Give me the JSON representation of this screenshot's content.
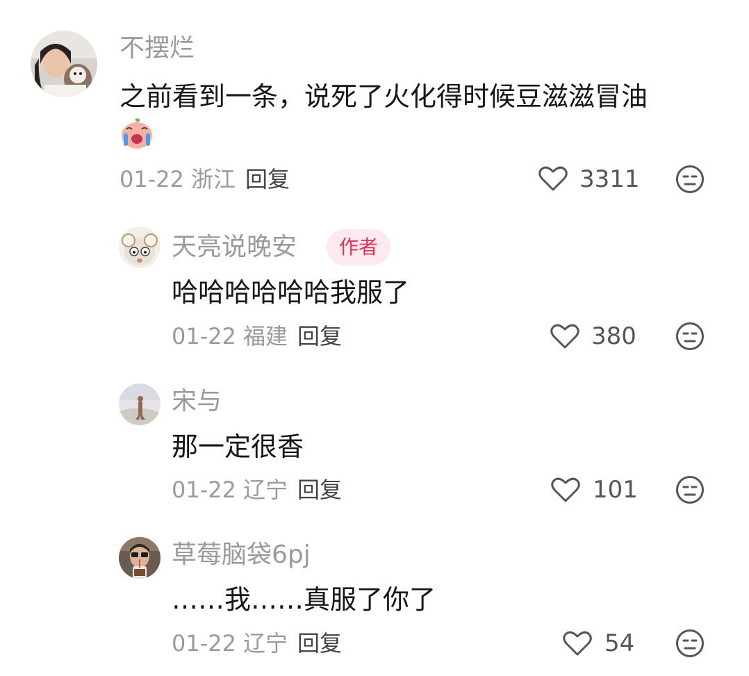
{
  "comments": [
    {
      "author": "不摆烂",
      "text": "之前看到一条，说死了火化得时候豆滋滋冒油",
      "emoji": "crying-laughing-emoji",
      "date": "01-22",
      "location": "浙江",
      "reply_label": "回复",
      "likes": "3311",
      "badge": null
    },
    {
      "author": "天亮说晚安",
      "badge": "作者",
      "text": "哈哈哈哈哈哈我服了",
      "date": "01-22",
      "location": "福建",
      "reply_label": "回复",
      "likes": "380"
    },
    {
      "author": "宋与",
      "text": "那一定很香",
      "date": "01-22",
      "location": "辽宁",
      "reply_label": "回复",
      "likes": "101",
      "badge": null
    },
    {
      "author": "草莓脑袋6pj",
      "text": "……我……真服了你了",
      "date": "01-22",
      "location": "辽宁",
      "reply_label": "回复",
      "likes": "54",
      "badge": null
    }
  ],
  "icons": {
    "like": "heart-outline-icon",
    "dislike": "unamused-face-icon"
  },
  "colors": {
    "author_badge_bg": "#fdeaee",
    "author_badge_text": "#e6335a",
    "muted_text": "#9a9a9a",
    "body_text": "#161616"
  }
}
